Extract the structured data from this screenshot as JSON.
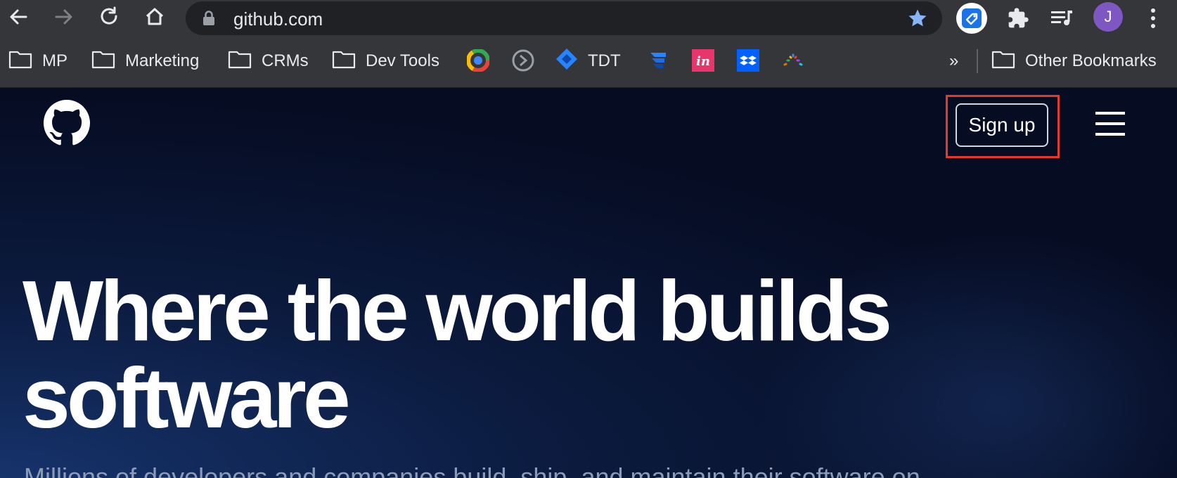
{
  "browser": {
    "url": "github.com",
    "avatar_initial": "J",
    "colors": {
      "chrome": "#35363a",
      "omnibox": "#202124",
      "star": "#8ab4f8",
      "avatar": "#7e57c2"
    },
    "toolbar_icons": [
      "back-arrow-icon",
      "forward-arrow-icon",
      "reload-icon",
      "home-icon",
      "lock-icon",
      "bookmark-star-icon",
      "tag-extension-icon",
      "puzzle-extensions-icon",
      "media-queue-icon",
      "kebab-menu-icon"
    ]
  },
  "bookmarks": {
    "folders": [
      {
        "label": "MP"
      },
      {
        "label": "Marketing"
      },
      {
        "label": "CRMs"
      },
      {
        "label": "Dev Tools"
      }
    ],
    "tdt_label": "TDT",
    "overflow_label": "»",
    "other_label": "Other Bookmarks",
    "icons": [
      "chrome-circle-icon",
      "arrow-circle-icon",
      "tdt-diamond-icon",
      "jira-icon",
      "invision-icon",
      "dropbox-icon",
      "dots-spinner-icon"
    ]
  },
  "page": {
    "signup_label": "Sign up",
    "hero_title": "Where the world builds software",
    "hero_subtitle": "Millions of developers and companies build, ship, and maintain their software on",
    "colors": {
      "highlight_box": "#e53a2b",
      "text": "#ffffff",
      "subtitle": "#8b9bb8"
    }
  }
}
